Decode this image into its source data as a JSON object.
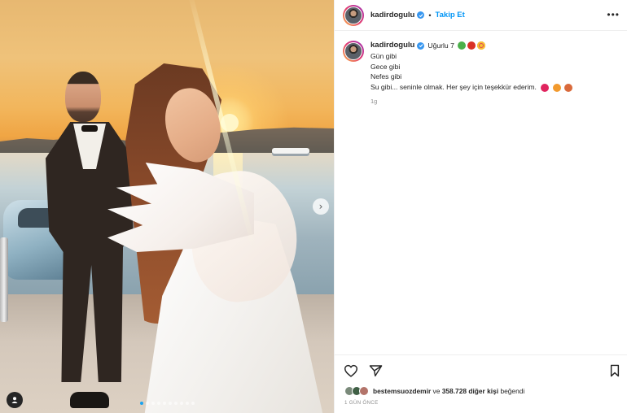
{
  "post": {
    "username": "kadirdogulu",
    "follow_label": "Takip Et",
    "separator": "•",
    "more_icon": "more-horizontal-icon",
    "caption": {
      "headline": "Uğurlu 7",
      "lines": [
        "Gün gibi",
        "Gece gibi",
        "Nefes gibi",
        "Su gibi... seninle olmak. Her şey için teşekkür ederim."
      ],
      "time": "1g",
      "headline_emojis": [
        "four-leaf-clover-icon",
        "ladybug-icon",
        "heart-eyes-face-icon"
      ],
      "thanks_emojis": [
        "red-heart-icon",
        "flame-heart-icon",
        "heart-icon"
      ]
    },
    "likes": {
      "liked_by_user": "bestemsuozdemir",
      "connector": "ve",
      "others": "358.728 diğer kişi",
      "suffix": "beğendi"
    },
    "posted_ago": "1 GÜN ÖNCE",
    "carousel": {
      "total_slides": 10,
      "active_index": 0
    }
  },
  "colors": {
    "accent": "#0095f6",
    "verified": "#3897f0",
    "text": "#262626",
    "muted": "#8e8e8e",
    "carousel_active": "#1aa3f0"
  }
}
